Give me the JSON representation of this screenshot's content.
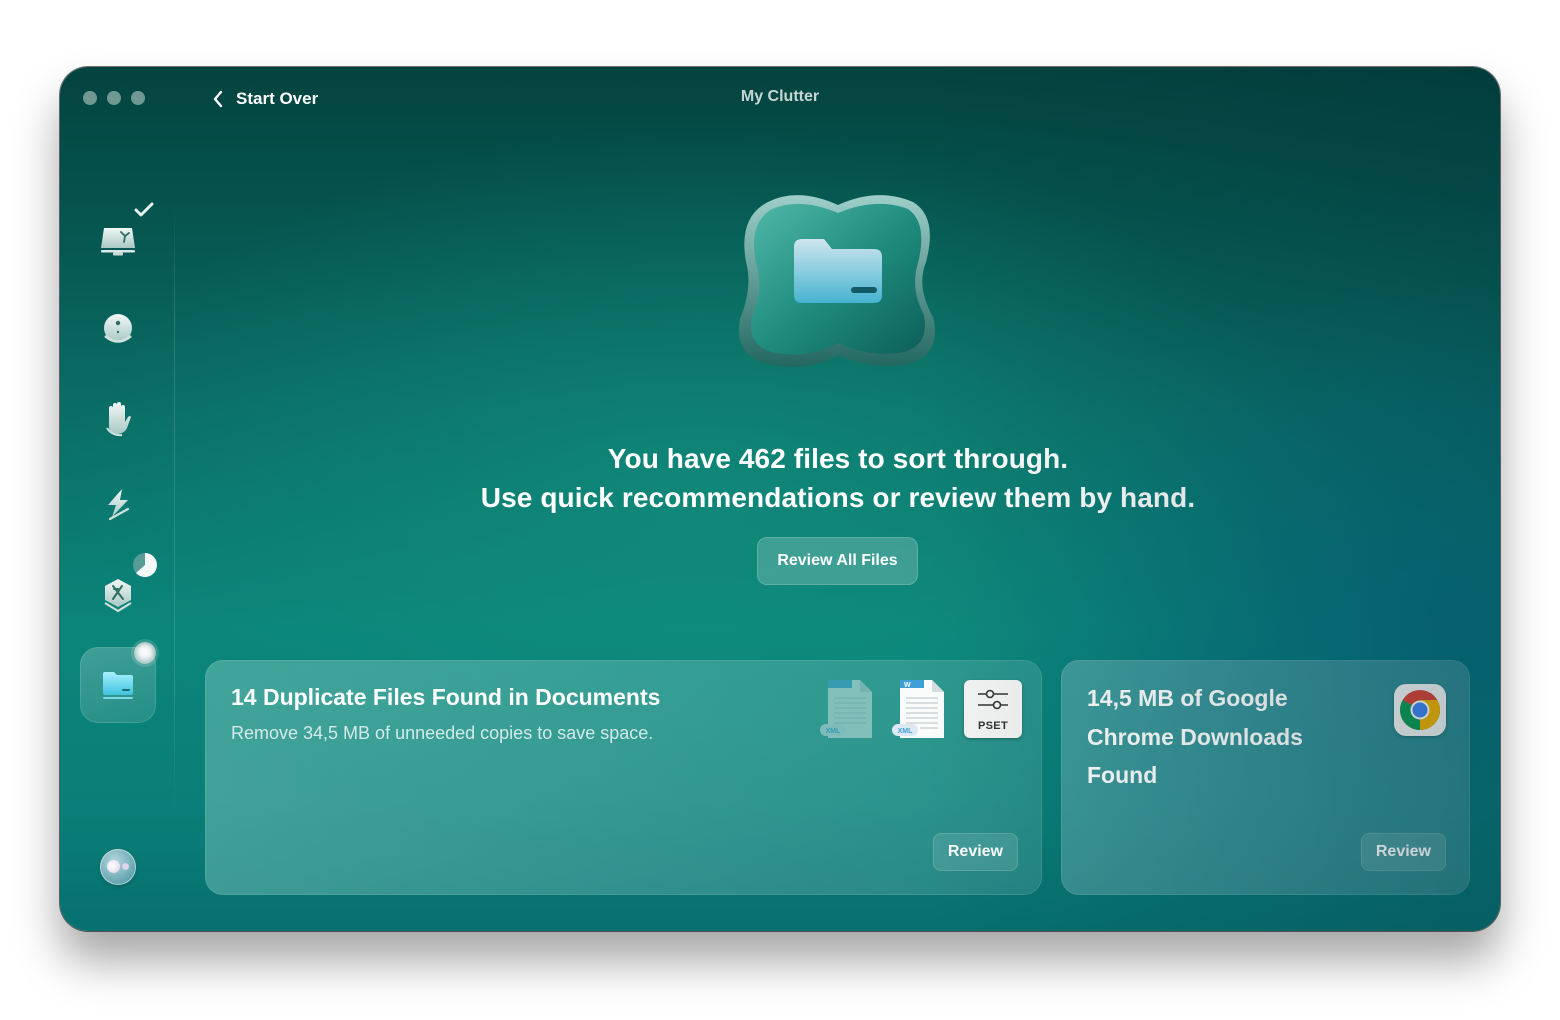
{
  "window": {
    "title": "My Clutter",
    "traffic_lights": [
      "close",
      "minimize",
      "zoom"
    ]
  },
  "header": {
    "back_label": "Start Over",
    "back_icon": "chevron-left-icon"
  },
  "sidebar": {
    "items": [
      {
        "name": "smart-care",
        "icon": "computer-cleanup-icon",
        "badge": "checkmark",
        "active": false
      },
      {
        "name": "cleanup",
        "icon": "disk-cleanup-icon",
        "badge": null,
        "active": false
      },
      {
        "name": "protection",
        "icon": "hand-protection-icon",
        "badge": null,
        "active": false
      },
      {
        "name": "performance",
        "icon": "lightning-icon",
        "badge": null,
        "active": false
      },
      {
        "name": "applications",
        "icon": "apps-icon",
        "badge": "progress-pie",
        "active": false
      },
      {
        "name": "my-clutter",
        "icon": "folder-icon",
        "badge": "dot",
        "active": true
      }
    ],
    "assistant_icon": "assistant-icon"
  },
  "hero": {
    "icon": "folder-icon",
    "line1": "You have 462 files to sort through.",
    "line2": "Use quick recommendations or review them by hand.",
    "button_label": "Review All Files"
  },
  "cards": [
    {
      "title": "14 Duplicate Files Found in Documents",
      "subtitle": "Remove 34,5 MB of unneeded copies to save space.",
      "file_icons": [
        {
          "type": "xml-doc-icon",
          "label": "XML",
          "faded": true
        },
        {
          "type": "xml-doc-icon",
          "label": "XML",
          "faded": false
        },
        {
          "type": "pset-icon",
          "label": "PSET",
          "faded": false
        }
      ],
      "button_label": "Review"
    },
    {
      "title": "14,5 MB of Google Chrome Downloads Found",
      "icon": "chrome-icon",
      "button_label": "Review"
    }
  ]
}
